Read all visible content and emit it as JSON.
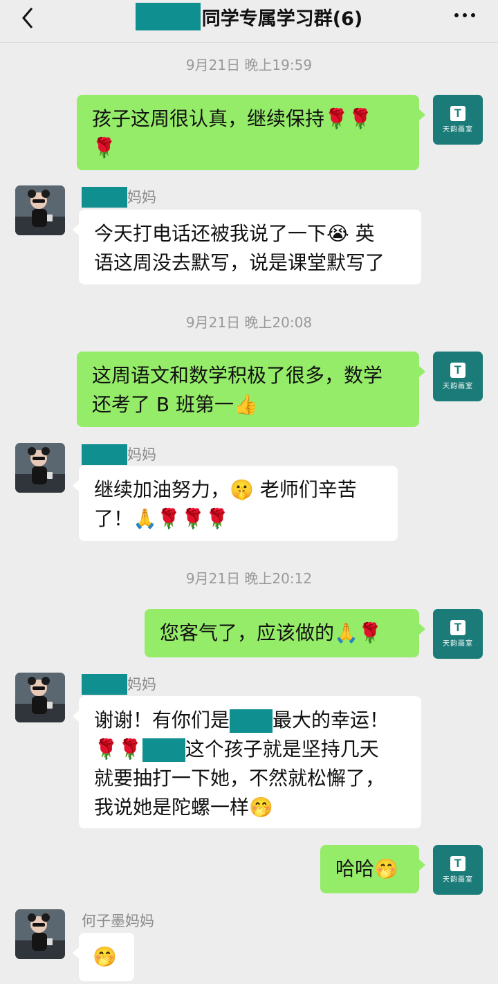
{
  "header": {
    "title": "同学专属学习群(6)"
  },
  "icons": {
    "back": "back-arrow-icon",
    "more": "more-dots-icon"
  },
  "colors": {
    "my_bubble": "#95ec69",
    "other_bubble": "#ffffff",
    "background": "#ededed",
    "redaction": "#0f8f8f"
  },
  "teacher_avatar": {
    "line1": "T",
    "line2": "天韵画室"
  },
  "messages": [
    {
      "time": "9月21日 晚上19:59"
    },
    {
      "from": "me",
      "text": "孩子这周很认真，继续保持🌹🌹\n🌹"
    },
    {
      "from": "other",
      "sender": "妈妈",
      "text": "今天打电话还被我说了一下😭 英\n语这周没去默写，说是课堂默写了"
    },
    {
      "time": "9月21日 晚上20:08"
    },
    {
      "from": "me",
      "text": "这周语文和数学积极了很多，数学\n还考了 B 班第一👍"
    },
    {
      "from": "other",
      "sender": "妈妈",
      "text": "继续加油努力，🤫 老师们辛苦\n了！🙏🌹🌹🌹"
    },
    {
      "time": "9月21日 晚上20:12"
    },
    {
      "from": "me",
      "text": "您客气了，应该做的🙏🌹"
    },
    {
      "from": "other",
      "sender": "妈妈",
      "text_line1_pre": "谢谢！有你们是",
      "text_line1_post": "最大的幸运！",
      "text_line2_pre": "🌹🌹",
      "text_line2_post": "这个孩子就是坚持几天",
      "text_rest": "就要抽打一下她，不然就松懈了，\n我说她是陀螺一样🤭"
    },
    {
      "from": "me",
      "text": "哈哈🤭"
    },
    {
      "from": "other",
      "sender": "何子墨妈妈",
      "text": "🤭"
    }
  ]
}
